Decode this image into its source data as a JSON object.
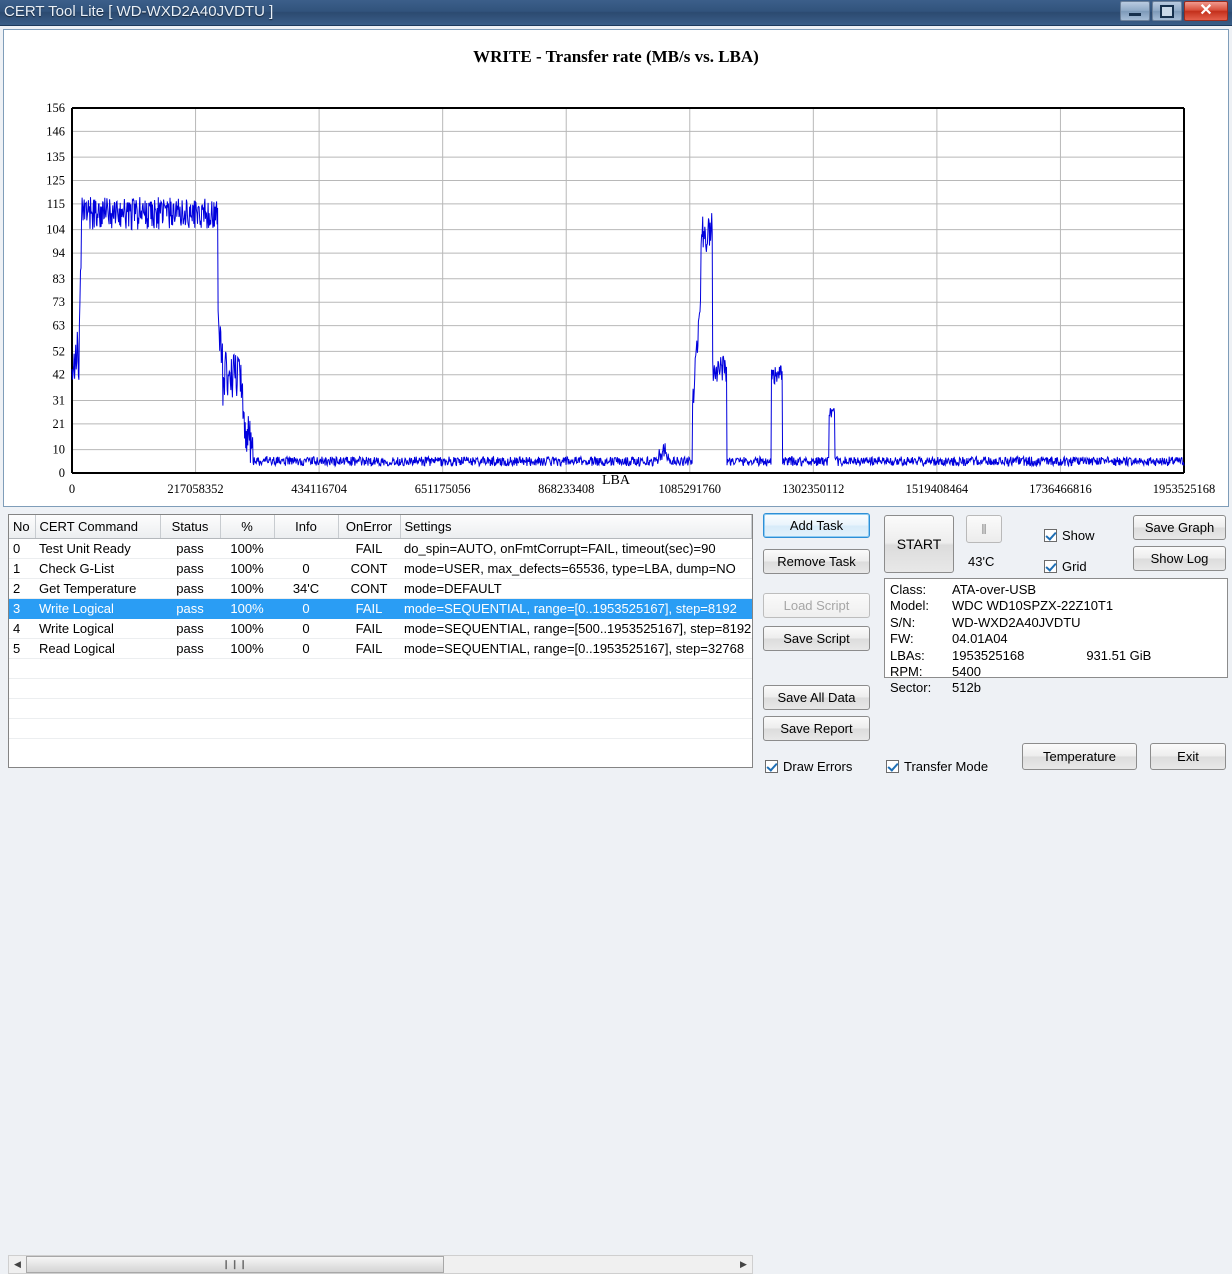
{
  "window": {
    "title": "CERT Tool Lite [ WD-WXD2A40JVDTU ]",
    "minimize_label": "",
    "maximize_label": "",
    "close_label": "✕"
  },
  "chart_data": {
    "type": "line",
    "title": "WRITE - Transfer rate (MB/s vs. LBA)",
    "xlabel": "LBA",
    "ylabel": "",
    "grid": true,
    "legend": "none",
    "xlim": [
      0,
      1953525168
    ],
    "ylim": [
      0,
      156
    ],
    "xticks": [
      0,
      217058352,
      434116704,
      651175056,
      868233408,
      1085291760,
      1302350112,
      1519408464,
      1736466816,
      1953525168
    ],
    "xticklabels": [
      "0",
      "217058352",
      "434116704",
      "651175056",
      "868233408",
      "1085291760",
      "1302350112",
      "1519408464",
      "1736466816",
      "1953525168"
    ],
    "yticks": [
      0,
      10,
      21,
      31,
      42,
      52,
      63,
      73,
      83,
      94,
      104,
      115,
      125,
      135,
      146,
      156
    ],
    "yticklabels": [
      "0",
      "10",
      "21",
      "31",
      "42",
      "52",
      "63",
      "73",
      "83",
      "94",
      "104",
      "115",
      "125",
      "135",
      "146",
      "156"
    ],
    "series_color": "#0000dd",
    "series": [
      {
        "name": "WRITE transfer rate",
        "segments": [
          {
            "x0": 0,
            "x1": 11000000,
            "level": 50,
            "noise": 11,
            "desc": "initial erratic ramp 40-64"
          },
          {
            "x0": 11000000,
            "x1": 16000000,
            "level": 85,
            "noise": 30,
            "desc": "rise to plateau"
          },
          {
            "x0": 16000000,
            "x1": 256000000,
            "level": 111,
            "noise": 7,
            "desc": "high plateau ~104-118"
          },
          {
            "x0": 256000000,
            "x1": 268000000,
            "level": 70,
            "noise": 28,
            "desc": "drop off plateau"
          },
          {
            "x0": 268000000,
            "x1": 300000000,
            "level": 42,
            "noise": 10,
            "desc": "mid shelf ~42-52"
          },
          {
            "x0": 300000000,
            "x1": 318000000,
            "level": 22,
            "noise": 18,
            "desc": "spiky fall to baseline"
          },
          {
            "x0": 318000000,
            "x1": 1030000000,
            "level": 5,
            "noise": 2,
            "desc": "low baseline"
          },
          {
            "x0": 1030000000,
            "x1": 1050000000,
            "level": 9,
            "noise": 4,
            "desc": "small bump"
          },
          {
            "x0": 1050000000,
            "x1": 1090000000,
            "level": 5,
            "noise": 2,
            "desc": "low baseline"
          },
          {
            "x0": 1090000000,
            "x1": 1105000000,
            "level": 77,
            "noise": 12,
            "desc": "rise of major spike"
          },
          {
            "x0": 1105000000,
            "x1": 1125000000,
            "level": 103,
            "noise": 9,
            "desc": "major spike peak ~110"
          },
          {
            "x0": 1125000000,
            "x1": 1150000000,
            "level": 45,
            "noise": 6,
            "desc": "secondary shelf"
          },
          {
            "x0": 1150000000,
            "x1": 1228000000,
            "level": 5,
            "noise": 2,
            "desc": "low baseline"
          },
          {
            "x0": 1228000000,
            "x1": 1248000000,
            "level": 42,
            "noise": 4,
            "desc": "spike ~42"
          },
          {
            "x0": 1248000000,
            "x1": 1330000000,
            "level": 5,
            "noise": 2,
            "desc": "low baseline"
          },
          {
            "x0": 1330000000,
            "x1": 1340000000,
            "level": 25,
            "noise": 3,
            "desc": "narrow spike ~25"
          },
          {
            "x0": 1340000000,
            "x1": 1953525168,
            "level": 5,
            "noise": 2,
            "desc": "low baseline to end"
          }
        ]
      }
    ]
  },
  "graph_controls": {
    "show_label": "Show",
    "grid_label": "Grid",
    "save_graph_label": "Save Graph",
    "show_log_label": "Show Log"
  },
  "task_table": {
    "columns": [
      "No",
      "CERT Command",
      "Status",
      "%",
      "Info",
      "OnError",
      "Settings"
    ],
    "rows": [
      {
        "no": "0",
        "command": "Test Unit Ready",
        "status": "pass",
        "percent": "100%",
        "info": "",
        "onerror": "FAIL",
        "settings": "do_spin=AUTO, onFmtCorrupt=FAIL, timeout(sec)=90",
        "selected": false
      },
      {
        "no": "1",
        "command": "Check G-List",
        "status": "pass",
        "percent": "100%",
        "info": "0",
        "onerror": "CONT",
        "settings": "mode=USER, max_defects=65536, type=LBA, dump=NO",
        "selected": false
      },
      {
        "no": "2",
        "command": "Get Temperature",
        "status": "pass",
        "percent": "100%",
        "info": "34'C",
        "onerror": "CONT",
        "settings": "mode=DEFAULT",
        "selected": false
      },
      {
        "no": "3",
        "command": "Write Logical",
        "status": "pass",
        "percent": "100%",
        "info": "0",
        "onerror": "FAIL",
        "settings": "mode=SEQUENTIAL, range=[0..1953525167], step=8192",
        "selected": true
      },
      {
        "no": "4",
        "command": "Write Logical",
        "status": "pass",
        "percent": "100%",
        "info": "0",
        "onerror": "FAIL",
        "settings": "mode=SEQUENTIAL, range=[500..1953525167], step=8192",
        "selected": false
      },
      {
        "no": "5",
        "command": "Read Logical",
        "status": "pass",
        "percent": "100%",
        "info": "0",
        "onerror": "FAIL",
        "settings": "mode=SEQUENTIAL, range=[0..1953525167], step=32768",
        "selected": false
      }
    ]
  },
  "task_buttons": {
    "add_task": "Add Task",
    "remove_task": "Remove Task",
    "load_script": "Load Script",
    "save_script": "Save Script",
    "save_all_data": "Save All Data",
    "save_report": "Save Report",
    "draw_errors": "Draw Errors"
  },
  "run_controls": {
    "start": "START",
    "pause": "‖",
    "temperature": "43'C",
    "transfer_mode": "Transfer Mode"
  },
  "drive_info": {
    "class_key": "Class:",
    "class_val": "ATA-over-USB",
    "model_key": "Model:",
    "model_val": "WDC WD10SPZX-22Z10T1",
    "sn_key": "S/N:",
    "sn_val": "WD-WXD2A40JVDTU",
    "fw_key": "FW:",
    "fw_val": "04.01A04",
    "lbas_key": "LBAs:",
    "lbas_val": "1953525168",
    "lbas_val2": "931.51 GiB",
    "rpm_key": "RPM:",
    "rpm_val": "5400",
    "sector_key": "Sector:",
    "sector_val": "512b"
  },
  "footer_buttons": {
    "temperature": "Temperature",
    "exit": "Exit"
  },
  "scrollbar": {
    "left_arrow": "◀",
    "right_arrow": "▶",
    "grip": "❙❙❙"
  }
}
